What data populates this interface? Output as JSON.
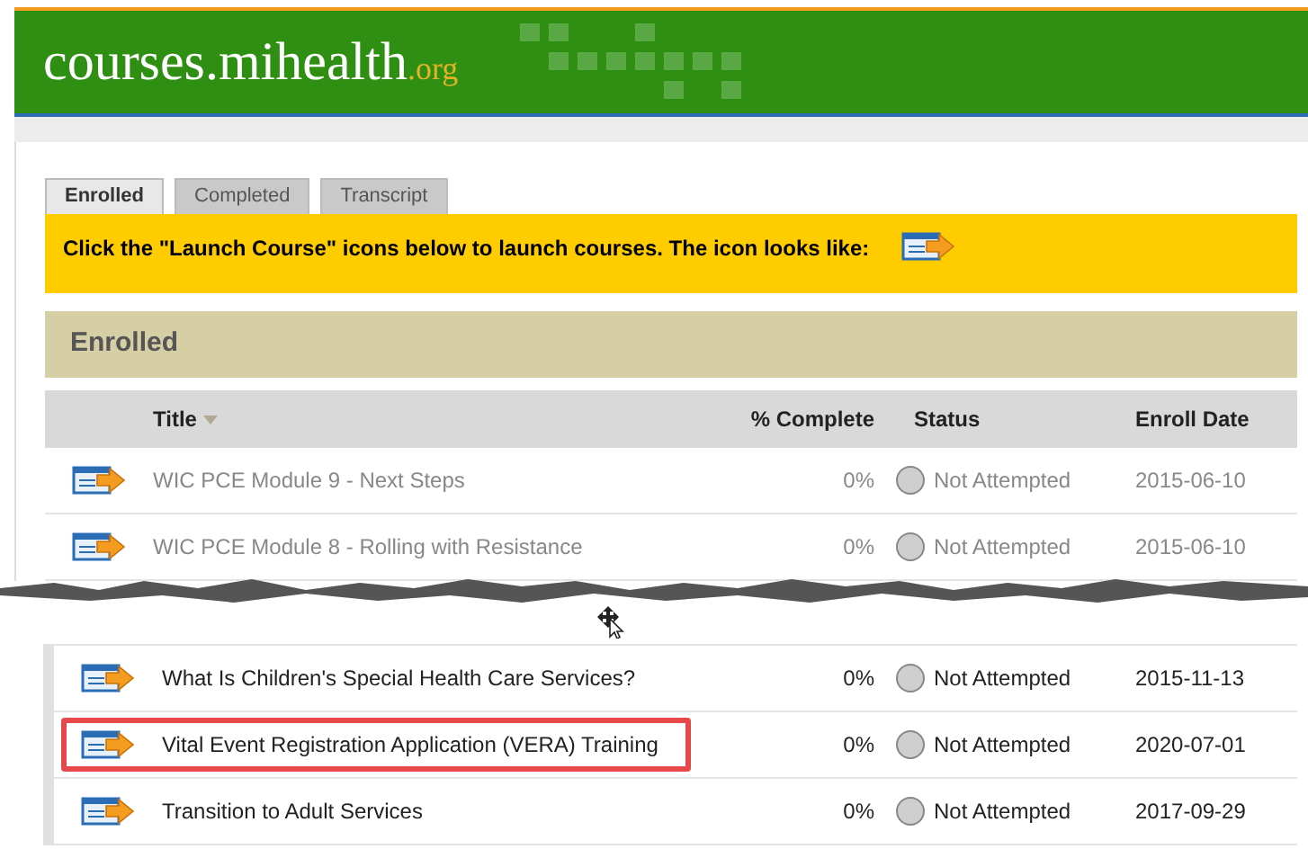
{
  "header": {
    "site_name": "courses.mihealth",
    "site_suffix": ".org"
  },
  "tabs": [
    {
      "label": "Enrolled",
      "selected": true
    },
    {
      "label": "Completed",
      "selected": false
    },
    {
      "label": "Transcript",
      "selected": false
    }
  ],
  "notice": "Click the \"Launch Course\" icons below to launch courses. The icon looks like:",
  "section_title": "Enrolled",
  "table": {
    "columns": [
      "Title",
      "% Complete",
      "Status",
      "Enroll Date"
    ],
    "rows_before_break": [
      {
        "title": "WIC PCE Module 9 - Next Steps",
        "complete": "0%",
        "status": "Not Attempted",
        "enroll_date": "2015-06-10",
        "muted": true,
        "highlighted": false
      },
      {
        "title": "WIC PCE Module 8 - Rolling with Resistance",
        "complete": "0%",
        "status": "Not Attempted",
        "enroll_date": "2015-06-10",
        "muted": true,
        "highlighted": false
      }
    ],
    "rows_after_break": [
      {
        "title": "What Is Children's Special Health Care Services?",
        "complete": "0%",
        "status": "Not Attempted",
        "enroll_date": "2015-11-13",
        "muted": false,
        "highlighted": false
      },
      {
        "title": "Vital Event Registration Application (VERA) Training",
        "complete": "0%",
        "status": "Not Attempted",
        "enroll_date": "2020-07-01",
        "muted": false,
        "highlighted": true
      },
      {
        "title": "Transition to Adult Services",
        "complete": "0%",
        "status": "Not Attempted",
        "enroll_date": "2017-09-29",
        "muted": false,
        "highlighted": false
      }
    ]
  }
}
